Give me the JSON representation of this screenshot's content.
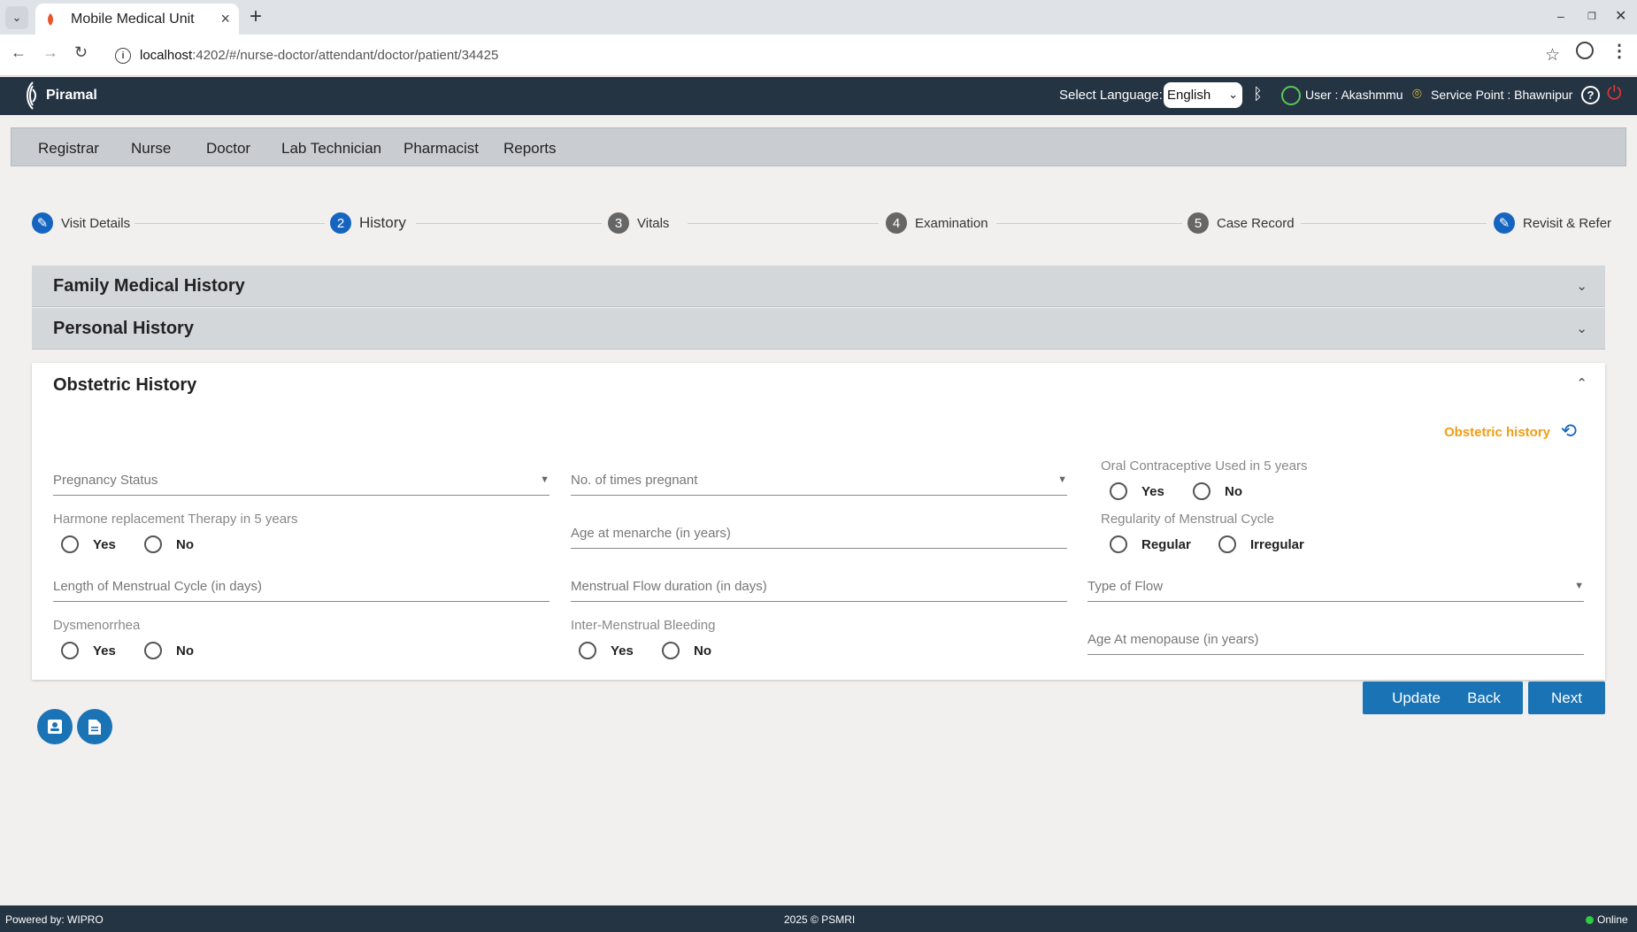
{
  "browser": {
    "tab_title": "Mobile Medical Unit",
    "url_host": "localhost",
    "url_path": ":4202/#/nurse-doctor/attendant/doctor/patient/34425"
  },
  "header": {
    "brand": "Piramal",
    "language_label": "Select Language:",
    "language_value": "English",
    "user_text": "User : Akashmmu",
    "service_point_text": "Service Point : Bhawnipur"
  },
  "roles": [
    "Registrar",
    "Nurse",
    "Doctor",
    "Lab Technician",
    "Pharmacist",
    "Reports"
  ],
  "stepper": [
    {
      "number": "",
      "label": "Visit Details"
    },
    {
      "number": "2",
      "label": "History"
    },
    {
      "number": "3",
      "label": "Vitals"
    },
    {
      "number": "4",
      "label": "Examination"
    },
    {
      "number": "5",
      "label": "Case Record"
    },
    {
      "number": "",
      "label": "Revisit & Refer"
    }
  ],
  "panels": {
    "family": "Family Medical History",
    "personal": "Personal History",
    "obstetric": "Obstetric History"
  },
  "obstetric": {
    "history_link": "Obstetric history",
    "pregnancy_status": "Pregnancy Status",
    "times_pregnant": "No. of times pregnant",
    "oral_contraceptive": "Oral Contraceptive Used in 5 years",
    "hrt": "Harmone replacement Therapy in 5 years",
    "age_menarche": "Age at menarche (in years)",
    "regularity": "Regularity of Menstrual Cycle",
    "cycle_length": "Length of Menstrual Cycle (in days)",
    "flow_duration": "Menstrual Flow duration (in days)",
    "type_of_flow": "Type of Flow",
    "dysmenorrhea": "Dysmenorrhea",
    "inter_bleeding": "Inter-Menstrual Bleeding",
    "age_menopause": "Age At menopause (in years)",
    "yes": "Yes",
    "no": "No",
    "regular": "Regular",
    "irregular": "Irregular"
  },
  "buttons": {
    "update": "Update",
    "back": "Back",
    "next": "Next"
  },
  "footer": {
    "powered_by": "Powered by: WIPRO",
    "copyright": "2025 © PSMRI",
    "status": "Online"
  },
  "colors": {
    "primary": "#1a73b5",
    "header_bg": "#253443",
    "accent_orange": "#f39c12"
  }
}
